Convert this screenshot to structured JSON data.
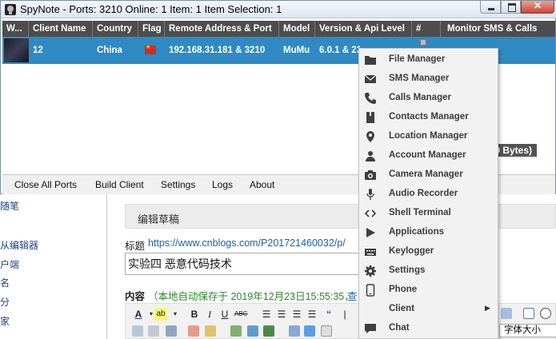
{
  "window": {
    "title": "SpyNote - Ports: 3210 Online: 1 Item: 1 Item Selection: 1"
  },
  "table": {
    "columns": [
      "W...",
      "Client Name",
      "Country",
      "Flag",
      "Remote Address & Port",
      "Model",
      "Version & Api Level",
      "#",
      "Monitor SMS & Calls"
    ],
    "row": {
      "client_name": "12",
      "country": "China",
      "remote_address": "192.168.31.181 & 3210",
      "model": "MuMu",
      "version": "6.0.1 & 23"
    },
    "footer_visible": "0 Bytes)"
  },
  "bottom_tabs": [
    "Close All Ports",
    "Build Client",
    "Settings",
    "Logs",
    "About"
  ],
  "context_menu": {
    "items": [
      {
        "label": "File Manager",
        "icon": "folder-icon"
      },
      {
        "label": "SMS Manager",
        "icon": "envelope-icon"
      },
      {
        "label": "Calls Manager",
        "icon": "phone-handset-icon"
      },
      {
        "label": "Contacts Manager",
        "icon": "contact-book-icon"
      },
      {
        "label": "Location Manager",
        "icon": "location-pin-icon"
      },
      {
        "label": "Account Manager",
        "icon": "user-icon"
      },
      {
        "label": "Camera Manager",
        "icon": "camera-icon"
      },
      {
        "label": "Audio Recorder",
        "icon": "microphone-icon"
      },
      {
        "label": "Shell Terminal",
        "icon": "code-brackets-icon"
      },
      {
        "label": "Applications",
        "icon": "play-icon"
      },
      {
        "label": "Keylogger",
        "icon": "keyboard-icon"
      },
      {
        "label": "Settings",
        "icon": "gear-icon"
      },
      {
        "label": "Phone",
        "icon": "smartphone-icon"
      },
      {
        "label": "Client",
        "icon": "",
        "submenu": true
      },
      {
        "label": "Chat",
        "icon": "chat-bubble-icon"
      }
    ]
  },
  "background_page": {
    "sidebar": [
      "随笔",
      "从编辑器",
      "户端",
      "名",
      "分",
      "家"
    ],
    "edit_header": "编辑草稿",
    "title_label": "标题",
    "title_url": "https://www.cnblogs.com/P201721460032/p/",
    "title_value": "实验四 恶意代码技术",
    "content_label": "内容",
    "autosave_text": "（本地自动保存于 2019年12月23日15:55:35，",
    "autosave_link": "查",
    "toolbar_font_size": "字体大小"
  }
}
